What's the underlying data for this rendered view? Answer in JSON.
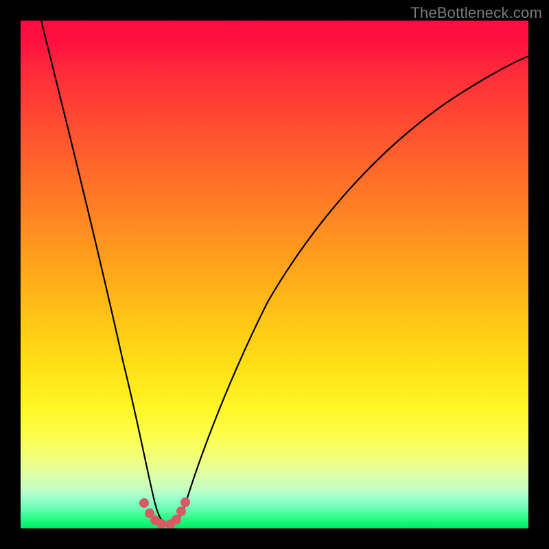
{
  "watermark": "TheBottleneck.com",
  "chart_data": {
    "type": "line",
    "title": "",
    "xlabel": "",
    "ylabel": "",
    "xlim": [
      0,
      100
    ],
    "ylim": [
      0,
      100
    ],
    "series": [
      {
        "name": "bottleneck-curve",
        "x": [
          4,
          12,
          18,
          22,
          24,
          25.5,
          27,
          29,
          31,
          33,
          37,
          44,
          55,
          68,
          82,
          100
        ],
        "y": [
          100,
          64,
          40,
          22,
          10,
          3,
          1,
          0.5,
          1,
          3,
          12,
          32,
          55,
          72,
          83,
          90
        ]
      }
    ],
    "markers": {
      "name": "valley-markers",
      "color": "#d85a63",
      "points": [
        {
          "x": 24.0,
          "y": 4.5
        },
        {
          "x": 25.0,
          "y": 2.5
        },
        {
          "x": 25.8,
          "y": 1.2
        },
        {
          "x": 27.0,
          "y": 0.6
        },
        {
          "x": 29.0,
          "y": 0.6
        },
        {
          "x": 30.2,
          "y": 1.4
        },
        {
          "x": 31.0,
          "y": 3.0
        },
        {
          "x": 31.8,
          "y": 4.8
        }
      ]
    },
    "gradient_stops": [
      {
        "pos": 0,
        "color": "#ff0d3e"
      },
      {
        "pos": 50,
        "color": "#ffb81a"
      },
      {
        "pos": 80,
        "color": "#fcff4e"
      },
      {
        "pos": 100,
        "color": "#00e865"
      }
    ]
  }
}
